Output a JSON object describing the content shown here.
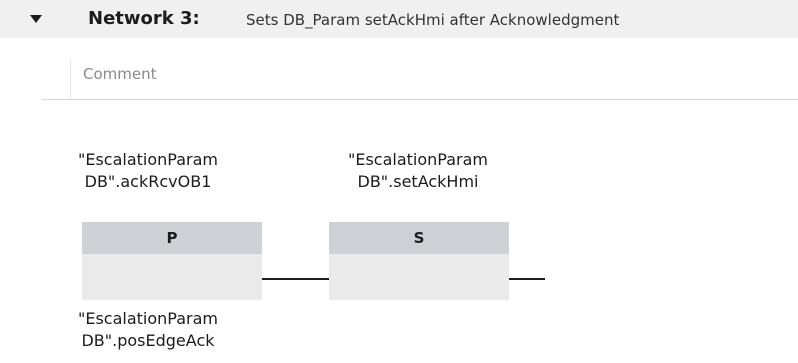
{
  "network": {
    "label": "Network 3:",
    "title": "Sets DB_Param setAckHmi after Acknowledgment",
    "comment_placeholder": "Comment"
  },
  "operands": {
    "p_top_line1": "\"EscalationParam",
    "p_top_line2": "DB\".ackRcvOB1",
    "s_top_line1": "\"EscalationParam",
    "s_top_line2": "DB\".setAckHmi",
    "p_bottom_line1": "\"EscalationParam",
    "p_bottom_line2": "DB\".posEdgeAck"
  },
  "instructions": {
    "p_label": "P",
    "s_label": "S"
  },
  "icons": {
    "collapse": "collapse-triangle-icon"
  }
}
